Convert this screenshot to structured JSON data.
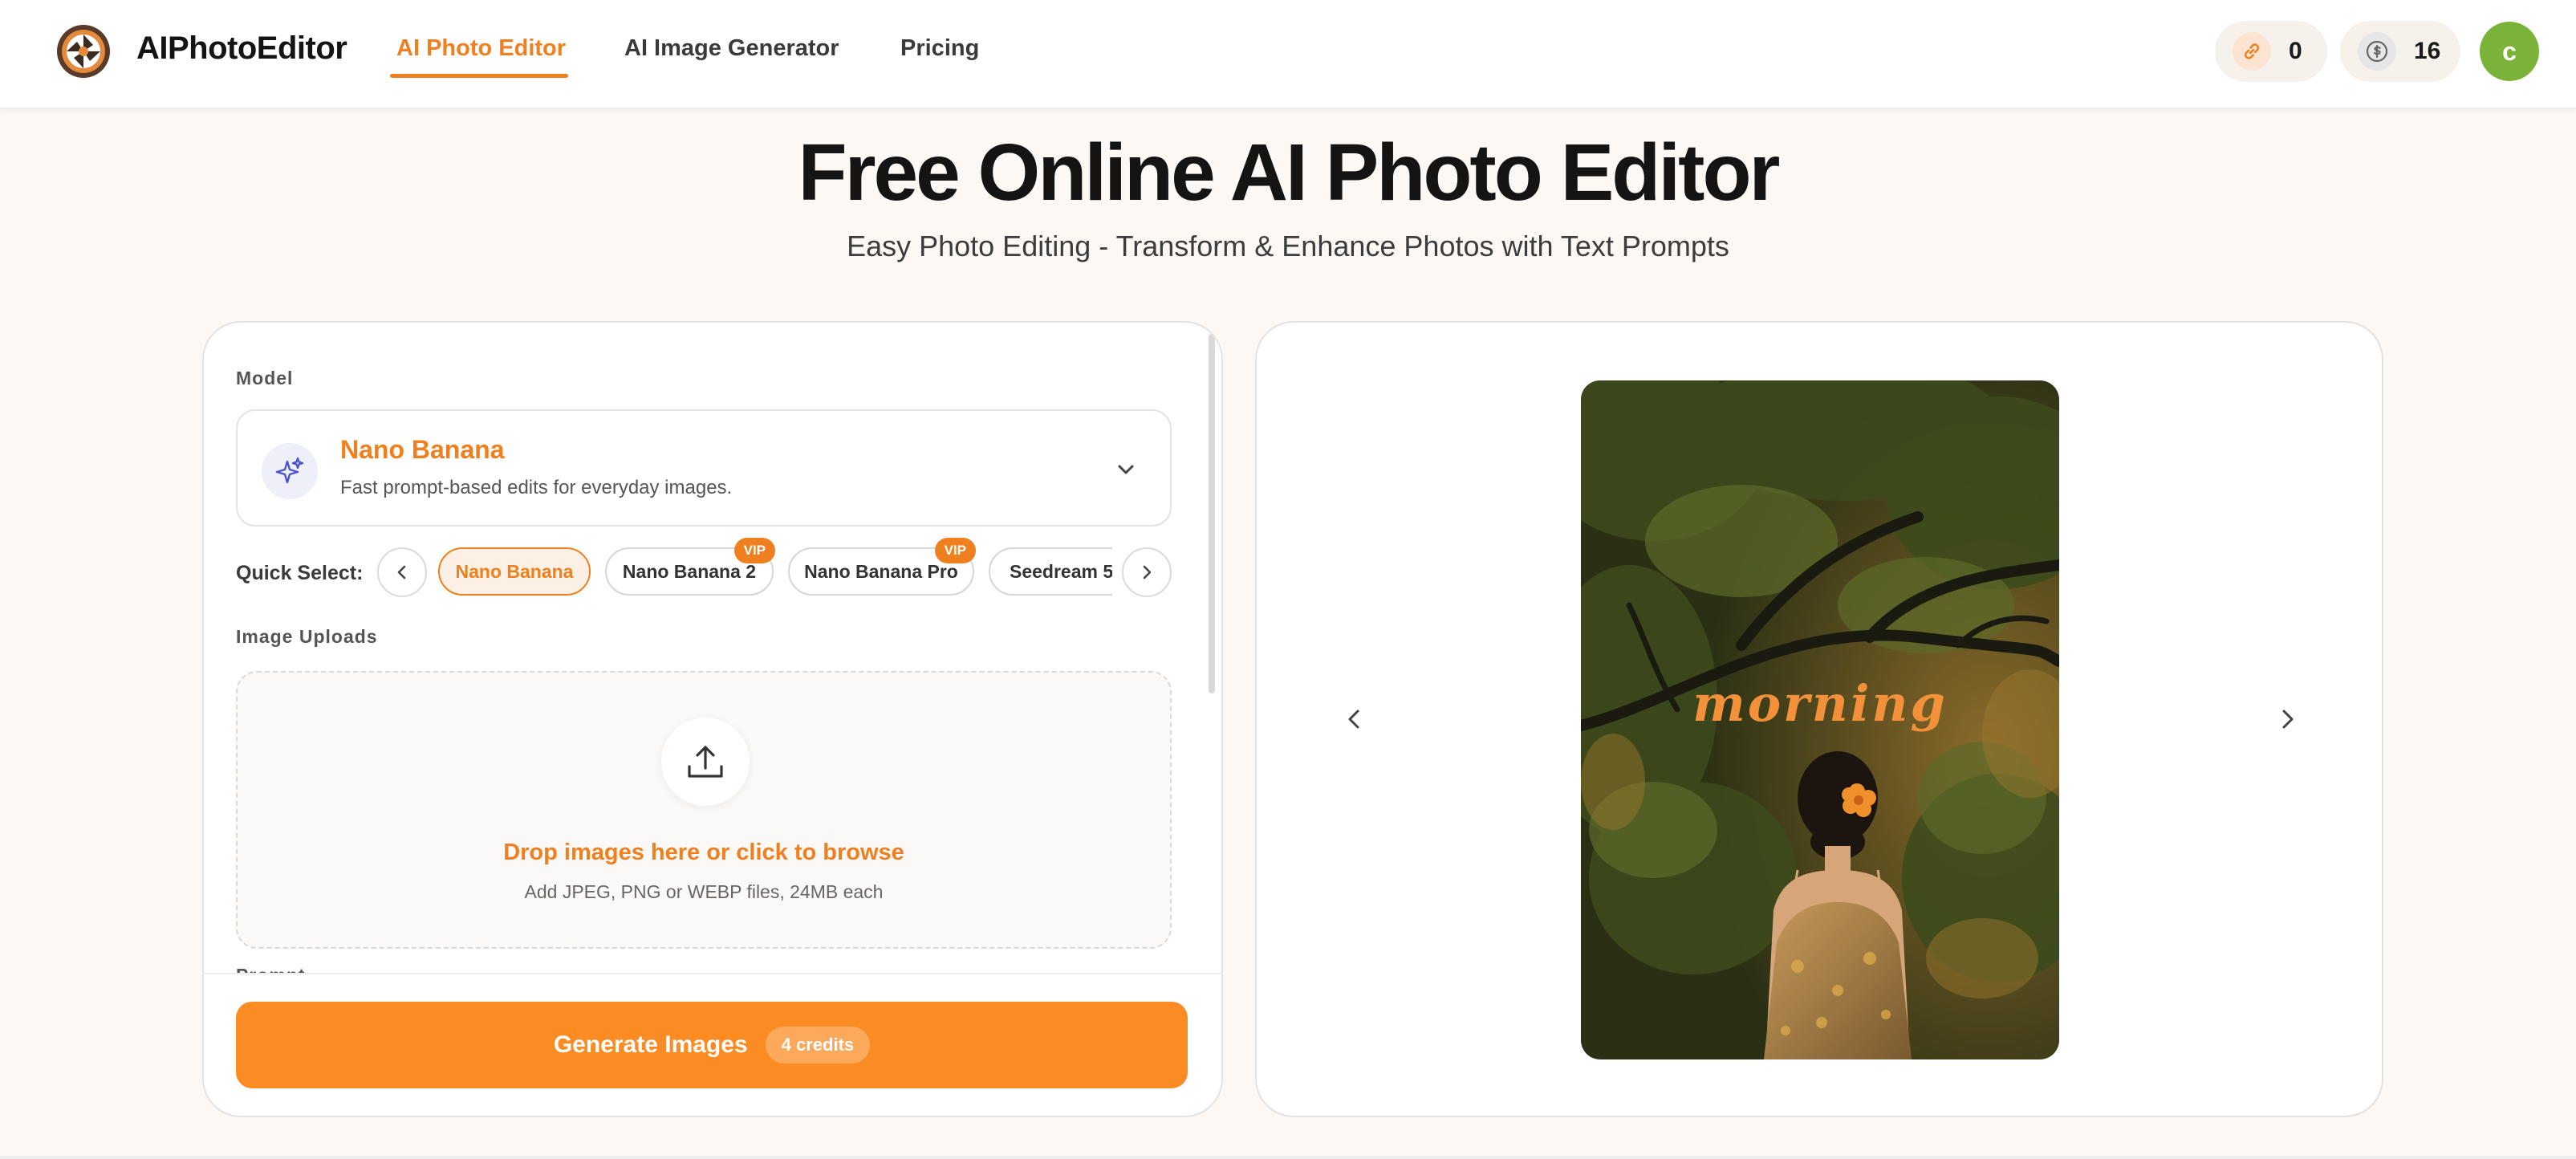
{
  "header": {
    "brand": "AIPhotoEditor",
    "nav": [
      {
        "label": "AI Photo Editor",
        "active": true
      },
      {
        "label": "AI Image Generator",
        "active": false
      },
      {
        "label": "Pricing",
        "active": false
      }
    ],
    "referral_count": "0",
    "credits": "16",
    "avatar_initial": "c",
    "icons": {
      "logo": "camera-aperture-icon",
      "referral": "link-icon",
      "credits": "coin-icon"
    },
    "colors": {
      "accent": "#f0801f",
      "avatar": "#7bb33a"
    }
  },
  "hero": {
    "title": "Free Online AI Photo Editor",
    "subtitle": "Easy Photo Editing - Transform & Enhance Photos with Text Prompts"
  },
  "editor": {
    "model_label": "Model",
    "model": {
      "name": "Nano Banana",
      "description": "Fast prompt-based edits for everyday images.",
      "icon": "sparkles-icon"
    },
    "quick_select_label": "Quick Select:",
    "quick_select": [
      {
        "label": "Nano Banana",
        "selected": true,
        "vip": false
      },
      {
        "label": "Nano Banana 2",
        "selected": false,
        "vip": true
      },
      {
        "label": "Nano Banana Pro",
        "selected": false,
        "vip": true
      },
      {
        "label": "Seedream 5",
        "selected": false,
        "vip": false
      }
    ],
    "vip_badge": "VIP",
    "uploads_label": "Image Uploads",
    "dropzone": {
      "title": "Drop images here or click to browse",
      "subtitle": "Add JPEG, PNG or WEBP files, 24MB each"
    },
    "prompt_label": "Prompt",
    "generate": {
      "label": "Generate Images",
      "credits_badge": "4 credits"
    }
  },
  "preview": {
    "overlay_text": "morning"
  }
}
